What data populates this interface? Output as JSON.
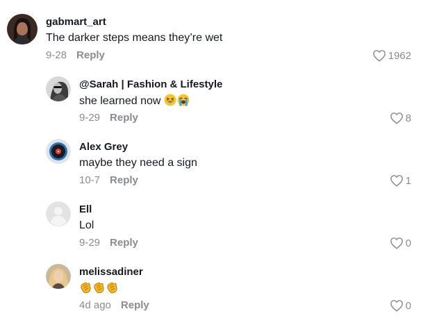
{
  "comments": [
    {
      "username": "gabmart_art",
      "text": "The darker steps means they’re wet",
      "date": "9-28",
      "reply": "Reply",
      "likes": "1962",
      "avatar": "woman-dark-hair-photo"
    },
    {
      "username": "@Sarah | Fashion & Lifestyle",
      "text": "she learned now",
      "emojis": [
        "grinning-squinting-face-emoji",
        "loudly-crying-face-emoji"
      ],
      "date": "9-29",
      "reply": "Reply",
      "likes": "8",
      "avatar": "woman-sunglasses-bw-photo"
    },
    {
      "username": "Alex Grey",
      "text": "maybe they need a sign",
      "date": "10-7",
      "reply": "Reply",
      "likes": "1",
      "avatar": "vinyl-record-avatar"
    },
    {
      "username": "Ell",
      "text": "Lol",
      "date": "9-29",
      "reply": "Reply",
      "likes": "0",
      "avatar": "default-avatar"
    },
    {
      "username": "melissadiner",
      "text": "",
      "emojis": [
        "clapping-hands-emoji",
        "clapping-hands-emoji",
        "clapping-hands-emoji"
      ],
      "date": "4d ago",
      "reply": "Reply",
      "likes": "0",
      "avatar": "blonde-woman-photo"
    }
  ],
  "colors": {
    "text": "#161823",
    "muted": "#8a8b91"
  }
}
